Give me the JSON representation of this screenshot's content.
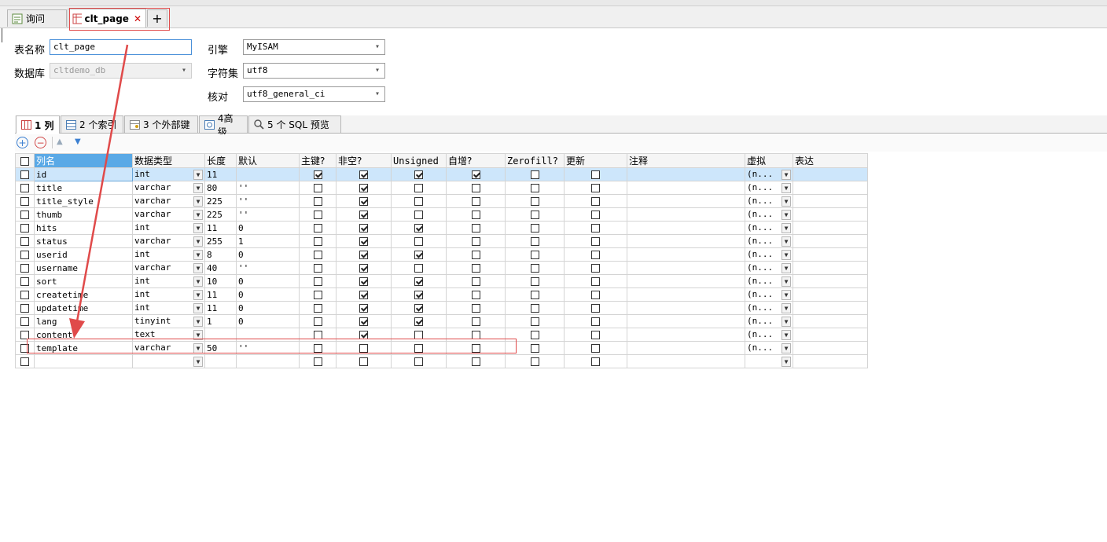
{
  "tabs": {
    "query_label": "询问",
    "table_label": "clt_page",
    "close_glyph": "✕",
    "add_glyph": "+"
  },
  "form": {
    "table_name_label": "表名称",
    "table_name_value": "clt_page",
    "database_label": "数据库",
    "database_value": "cltdemo_db",
    "engine_label": "引擎",
    "engine_value": "MyISAM",
    "charset_label": "字符集",
    "charset_value": "utf8",
    "collation_label": "核对",
    "collation_value": "utf8_general_ci"
  },
  "subtabs": [
    "1 列",
    "2 个索引",
    "3 个外部键",
    "4高级",
    "5 个 SQL 预览"
  ],
  "columns": [
    "列名",
    "数据类型",
    "长度",
    "默认",
    "主键?",
    "非空?",
    "Unsigned",
    "自增?",
    "Zerofill?",
    "更新",
    "注释",
    "虚拟",
    "表达"
  ],
  "rows": [
    {
      "name": "id",
      "type": "int",
      "len": "11",
      "def": "",
      "pk": true,
      "nn": true,
      "uns": true,
      "ai": true,
      "zf": false,
      "upd": false,
      "virt": "(n..."
    },
    {
      "name": "title",
      "type": "varchar",
      "len": "80",
      "def": "''",
      "pk": false,
      "nn": true,
      "uns": false,
      "ai": false,
      "zf": false,
      "upd": false,
      "virt": "(n..."
    },
    {
      "name": "title_style",
      "type": "varchar",
      "len": "225",
      "def": "''",
      "pk": false,
      "nn": true,
      "uns": false,
      "ai": false,
      "zf": false,
      "upd": false,
      "virt": "(n..."
    },
    {
      "name": "thumb",
      "type": "varchar",
      "len": "225",
      "def": "''",
      "pk": false,
      "nn": true,
      "uns": false,
      "ai": false,
      "zf": false,
      "upd": false,
      "virt": "(n..."
    },
    {
      "name": "hits",
      "type": "int",
      "len": "11",
      "def": "0",
      "pk": false,
      "nn": true,
      "uns": true,
      "ai": false,
      "zf": false,
      "upd": false,
      "virt": "(n..."
    },
    {
      "name": "status",
      "type": "varchar",
      "len": "255",
      "def": "1",
      "pk": false,
      "nn": true,
      "uns": false,
      "ai": false,
      "zf": false,
      "upd": false,
      "virt": "(n..."
    },
    {
      "name": "userid",
      "type": "int",
      "len": "8",
      "def": "0",
      "pk": false,
      "nn": true,
      "uns": true,
      "ai": false,
      "zf": false,
      "upd": false,
      "virt": "(n..."
    },
    {
      "name": "username",
      "type": "varchar",
      "len": "40",
      "def": "''",
      "pk": false,
      "nn": true,
      "uns": false,
      "ai": false,
      "zf": false,
      "upd": false,
      "virt": "(n..."
    },
    {
      "name": "sort",
      "type": "int",
      "len": "10",
      "def": "0",
      "pk": false,
      "nn": true,
      "uns": true,
      "ai": false,
      "zf": false,
      "upd": false,
      "virt": "(n..."
    },
    {
      "name": "createtime",
      "type": "int",
      "len": "11",
      "def": "0",
      "pk": false,
      "nn": true,
      "uns": true,
      "ai": false,
      "zf": false,
      "upd": false,
      "virt": "(n..."
    },
    {
      "name": "updatetime",
      "type": "int",
      "len": "11",
      "def": "0",
      "pk": false,
      "nn": true,
      "uns": true,
      "ai": false,
      "zf": false,
      "upd": false,
      "virt": "(n..."
    },
    {
      "name": "lang",
      "type": "tinyint",
      "len": "1",
      "def": "0",
      "pk": false,
      "nn": true,
      "uns": true,
      "ai": false,
      "zf": false,
      "upd": false,
      "virt": "(n..."
    },
    {
      "name": "content",
      "type": "text",
      "len": "",
      "def": "",
      "pk": false,
      "nn": true,
      "uns": false,
      "ai": false,
      "zf": false,
      "upd": false,
      "virt": "(n..."
    },
    {
      "name": "template",
      "type": "varchar",
      "len": "50",
      "def": "''",
      "pk": false,
      "nn": false,
      "uns": false,
      "ai": false,
      "zf": false,
      "upd": false,
      "virt": "(n..."
    },
    {
      "name": "",
      "type": "",
      "len": "",
      "def": "",
      "pk": false,
      "nn": false,
      "uns": false,
      "ai": false,
      "zf": false,
      "upd": false,
      "virt": ""
    }
  ],
  "colors": {
    "accent": "#5aa9e6",
    "selected_row": "#cde6fb",
    "annotation_red": "#e04a4a",
    "add_icon": "#3b7fd1",
    "remove_icon": "#d24b4b"
  }
}
